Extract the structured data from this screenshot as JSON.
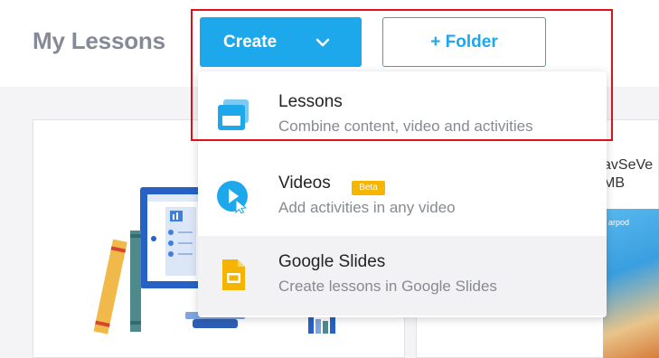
{
  "header": {
    "title": "My Lessons",
    "create_label": "Create",
    "folder_label": "+ Folder"
  },
  "dropdown": {
    "items": [
      {
        "title": "Lessons",
        "description": "Combine content, video and activities",
        "icon": "lesson-window-icon"
      },
      {
        "title": "Videos",
        "badge": "Beta",
        "description": "Add activities in any video",
        "icon": "video-play-icon"
      },
      {
        "title": "Google Slides",
        "description": "Create lessons in Google Slides",
        "icon": "google-slides-icon"
      }
    ]
  },
  "cards": {
    "right_title_line1": "avSeVe",
    "right_title_line2": "MB",
    "thumb_text": "arpod"
  },
  "colors": {
    "brand_blue": "#1ea8ec",
    "beta_badge": "#f7b500",
    "highlight": "#e0101a",
    "slides_yellow": "#f4b400"
  }
}
